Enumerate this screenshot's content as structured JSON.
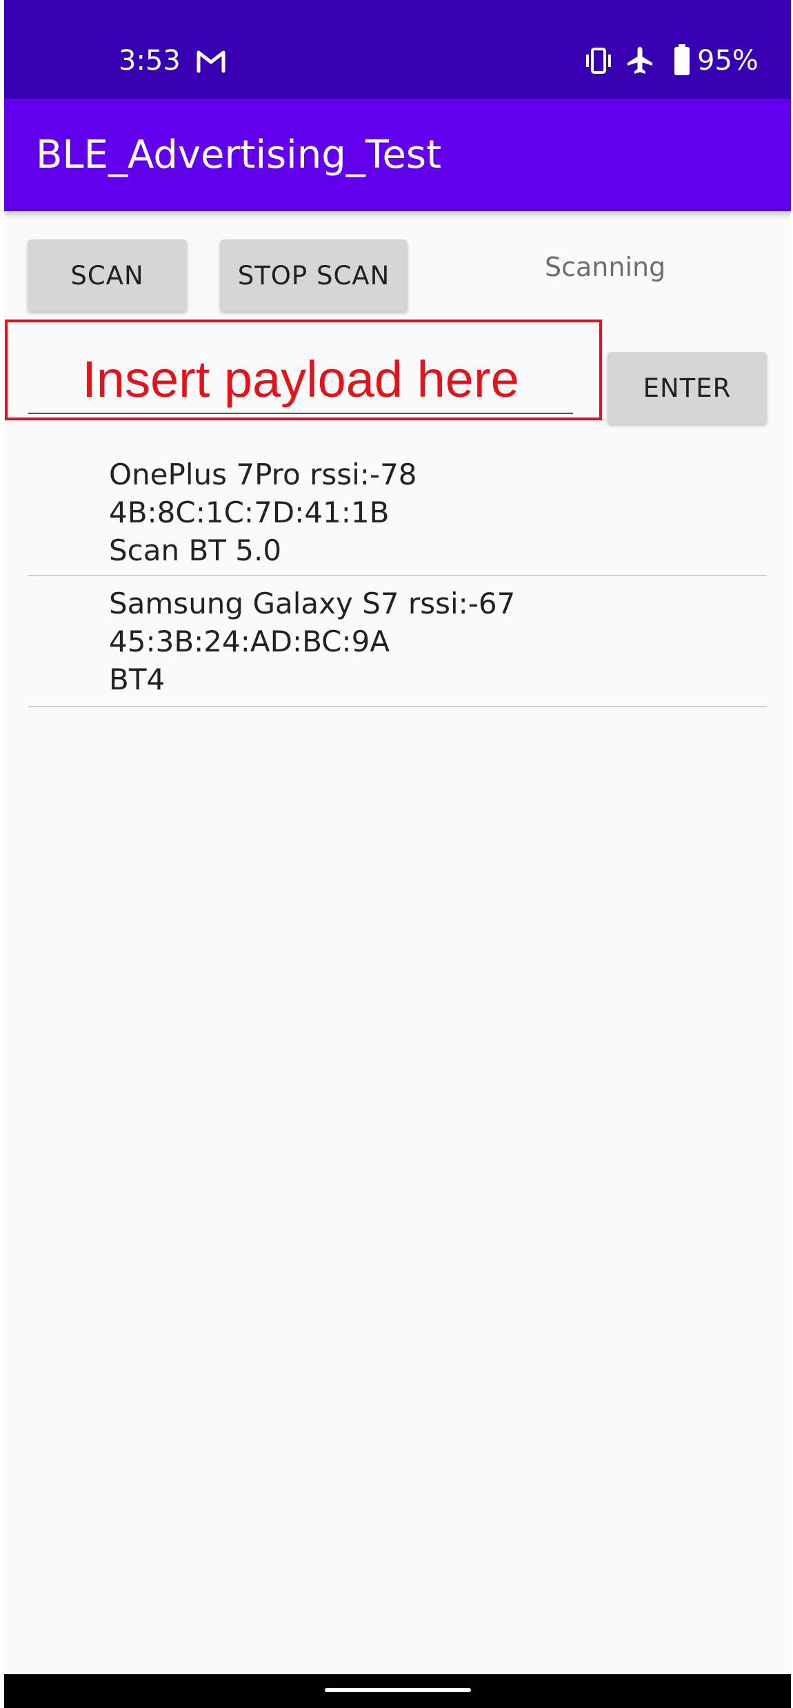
{
  "status_bar": {
    "time": "3:53",
    "battery_percent": "95%",
    "icons": [
      "gmail-icon",
      "vibrate-icon",
      "airplane-mode-icon",
      "battery-icon"
    ],
    "background": "#3700b3"
  },
  "app_bar": {
    "title": "BLE_Advertising_Test",
    "background": "#6200ee"
  },
  "controls": {
    "scan_label": "SCAN",
    "stop_scan_label": "STOP SCAN",
    "status_text": "Scanning",
    "enter_label": "ENTER"
  },
  "payload": {
    "placeholder": "Insert payload here",
    "value": "",
    "highlight_color": "#e2141a"
  },
  "devices": [
    {
      "name_rssi": "OnePlus 7Pro rssi:-78",
      "address": "4B:8C:1C:7D:41:1B",
      "info": "Scan BT 5.0"
    },
    {
      "name_rssi": "Samsung Galaxy S7 rssi:-67",
      "address": "45:3B:24:AD:BC:9A",
      "info": "BT4"
    }
  ]
}
